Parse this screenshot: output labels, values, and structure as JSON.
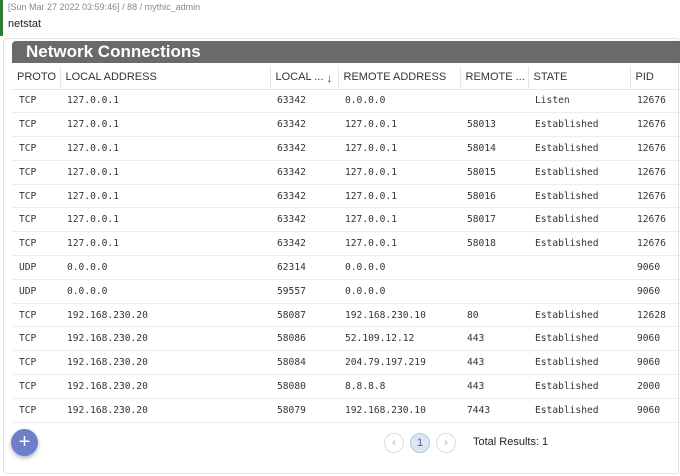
{
  "task": {
    "meta": "[Sun Mar 27 2022 03:59:46] / 88 / mythic_admin",
    "command": "netstat"
  },
  "panel": {
    "title": "Network Connections"
  },
  "columns": [
    {
      "key": "proto",
      "label": "PROTO"
    },
    {
      "key": "local_address",
      "label": "LOCAL ADDRESS"
    },
    {
      "key": "local_port",
      "label": "LOCAL ...",
      "sorted": "descending"
    },
    {
      "key": "remote_address",
      "label": "REMOTE ADDRESS"
    },
    {
      "key": "remote_port",
      "label": "REMOTE ..."
    },
    {
      "key": "state",
      "label": "STATE"
    },
    {
      "key": "pid",
      "label": "PID"
    }
  ],
  "rows": [
    [
      "TCP",
      "127.0.0.1",
      "63342",
      "0.0.0.0",
      "",
      "Listen",
      "12676"
    ],
    [
      "TCP",
      "127.0.0.1",
      "63342",
      "127.0.0.1",
      "58013",
      "Established",
      "12676"
    ],
    [
      "TCP",
      "127.0.0.1",
      "63342",
      "127.0.0.1",
      "58014",
      "Established",
      "12676"
    ],
    [
      "TCP",
      "127.0.0.1",
      "63342",
      "127.0.0.1",
      "58015",
      "Established",
      "12676"
    ],
    [
      "TCP",
      "127.0.0.1",
      "63342",
      "127.0.0.1",
      "58016",
      "Established",
      "12676"
    ],
    [
      "TCP",
      "127.0.0.1",
      "63342",
      "127.0.0.1",
      "58017",
      "Established",
      "12676"
    ],
    [
      "TCP",
      "127.0.0.1",
      "63342",
      "127.0.0.1",
      "58018",
      "Established",
      "12676"
    ],
    [
      "UDP",
      "0.0.0.0",
      "62314",
      "0.0.0.0",
      "",
      "",
      "9060"
    ],
    [
      "UDP",
      "0.0.0.0",
      "59557",
      "0.0.0.0",
      "",
      "",
      "9060"
    ],
    [
      "TCP",
      "192.168.230.20",
      "58087",
      "192.168.230.10",
      "80",
      "Established",
      "12628"
    ],
    [
      "TCP",
      "192.168.230.20",
      "58086",
      "52.109.12.12",
      "443",
      "Established",
      "9060"
    ],
    [
      "TCP",
      "192.168.230.20",
      "58084",
      "204.79.197.219",
      "443",
      "Established",
      "9060"
    ],
    [
      "TCP",
      "192.168.230.20",
      "58080",
      "8.8.8.8",
      "443",
      "Established",
      "2000"
    ],
    [
      "TCP",
      "192.168.230.20",
      "58079",
      "192.168.230.10",
      "7443",
      "Established",
      "9060"
    ]
  ],
  "pagination": {
    "prev_icon": "chevron-left-icon",
    "prev_glyph": "‹",
    "current_page": "1",
    "next_icon": "chevron-right-icon",
    "next_glyph": "›"
  },
  "total": {
    "label": "Total Results:",
    "value": "1"
  },
  "fab": {
    "icon": "plus-icon",
    "glyph": "+"
  },
  "sort_glyph": "↓",
  "colors": {
    "accent": "#2e7d32",
    "title_bar": "#6a6a6a",
    "fab": "#6d7fc9"
  }
}
